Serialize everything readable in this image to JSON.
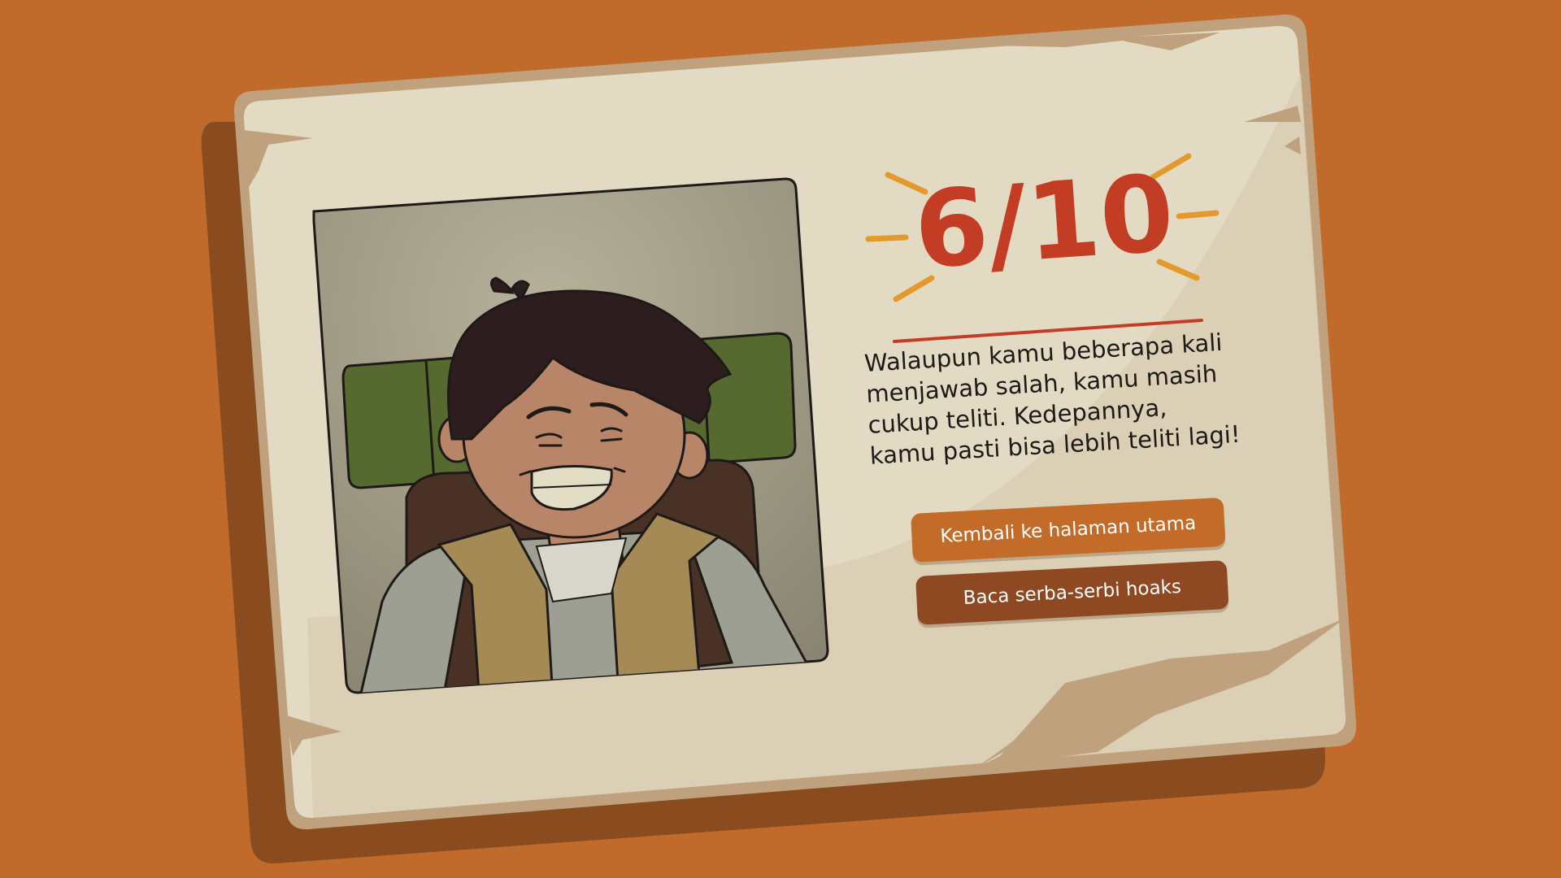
{
  "score": {
    "value": "6/10"
  },
  "message": {
    "lines": [
      "Walaupun kamu beberapa kali",
      "menjawab salah, kamu masih",
      "cukup teliti. Kedepannya,",
      "kamu pasti bisa lebih teliti lagi!"
    ]
  },
  "buttons": {
    "home_label": "Kembali ke halaman utama",
    "hoax_label": "Baca serba-serbi hoaks"
  },
  "colors": {
    "background": "#c06a2b",
    "score": "#c23d24",
    "accent_rays": "#e39a2a",
    "button_primary": "#c36b28",
    "button_secondary": "#8e4822"
  }
}
